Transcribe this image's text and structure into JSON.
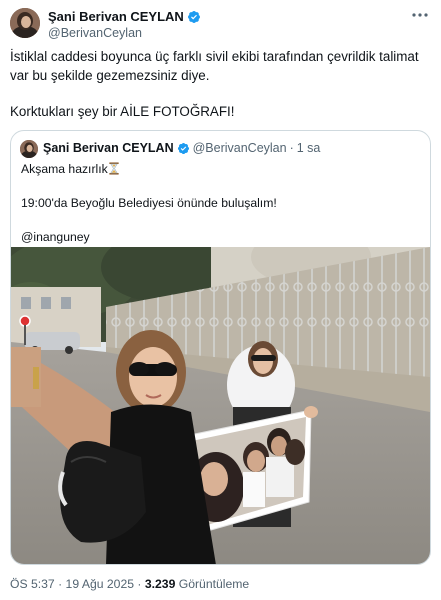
{
  "author": {
    "display_name": "Şani Berivan CEYLAN",
    "handle": "@BerivanCeylan",
    "verified_icon": "verified-badge-icon"
  },
  "tweet": {
    "line1": "İstiklal caddesi boyunca üç farklı sivil ekibi tarafından çevrildik talimat var bu şekilde gezemezsiniz diye.",
    "line2": "Korktukları şey bir AİLE FOTOĞRAFI!"
  },
  "quoted": {
    "display_name": "Şani Berivan CEYLAN",
    "handle": "@BerivanCeylan",
    "separator": "·",
    "time": "1 sa",
    "text1": "Akşama hazırlık",
    "text2": "19:00'da Beyoğlu Belediyesi önünde buluşalım!",
    "text3": "@inanguney",
    "emoji_icon": "hourglass-icon"
  },
  "footer": {
    "timestamp": "ÖS 5:37 · 19 Ağu 2025 · ",
    "views_count": "3.239",
    "views_label": " Görüntüleme"
  },
  "colors": {
    "text": "#0f1419",
    "secondary": "#536471",
    "verified": "#1d9bf0",
    "border": "#cfd9de"
  }
}
